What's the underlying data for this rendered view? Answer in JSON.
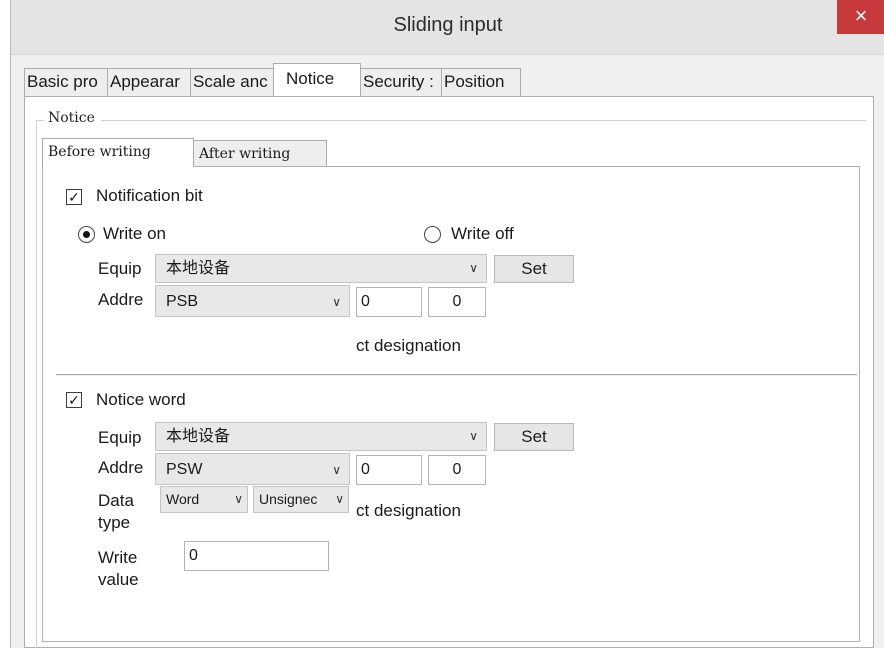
{
  "window": {
    "title": "Sliding input",
    "close_glyph": "×",
    "close_icon": "close-icon"
  },
  "tabs": [
    {
      "label": "Basic pro"
    },
    {
      "label": "Appearar"
    },
    {
      "label": "Scale anc"
    },
    {
      "label": "Notice"
    },
    {
      "label": "Security :"
    },
    {
      "label": "Position"
    }
  ],
  "active_tab": "Notice",
  "group": {
    "label": "Notice"
  },
  "inner_tabs": [
    {
      "label": "Before writing"
    },
    {
      "label": "After writing"
    }
  ],
  "notification_bit": {
    "label": "Notification bit",
    "checked": true,
    "check_glyph": "✓",
    "write_on_label": "Write on",
    "write_off_label": "Write off",
    "selected_mode": "Write on",
    "equip_label": "Equip",
    "equip_value": "本地设备",
    "set_label": "Set",
    "addr_label": "Addre",
    "addr_type": "PSB",
    "addr_value_1": "0",
    "addr_value_2": "0",
    "indirect_label": "ct designation"
  },
  "notice_word": {
    "label": "Notice word",
    "checked": true,
    "check_glyph": "✓",
    "equip_label": "Equip",
    "equip_value": "本地设备",
    "set_label": "Set",
    "addr_label": "Addre",
    "addr_type": "PSW",
    "addr_value_1": "0",
    "addr_value_2": "0",
    "data_type_label_1": "Data",
    "data_type_label_2": "type",
    "data_type_value": "Word",
    "sign_value": "Unsignec",
    "indirect_label": "ct designation",
    "write_value_label_1": "Write",
    "write_value_label_2": "value",
    "write_value": "0"
  },
  "dropdown_arrow": "∨",
  "colors": {
    "close_button": "#c7393a",
    "titlebar": "#e4e4e4",
    "panel": "#ffffff",
    "dialog_bg": "#f0f0f0"
  }
}
